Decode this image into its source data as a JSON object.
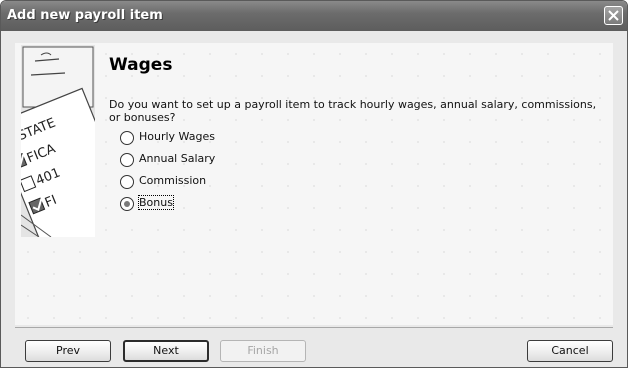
{
  "window": {
    "title": "Add new payroll item"
  },
  "icons": {
    "close": "close-icon",
    "illustration": "payroll-forms-illustration"
  },
  "illustration_text": [
    "STATE",
    "FICA",
    "401",
    "FI"
  ],
  "page": {
    "heading": "Wages",
    "question": "Do you want to set up a payroll item to track hourly wages, annual salary, commissions, or bonuses?"
  },
  "options": [
    {
      "label": "Hourly Wages",
      "checked": false
    },
    {
      "label": "Annual Salary",
      "checked": false
    },
    {
      "label": "Commission",
      "checked": false
    },
    {
      "label": "Bonus",
      "checked": true
    }
  ],
  "buttons": {
    "prev": "Prev",
    "next": "Next",
    "finish": "Finish",
    "cancel": "Cancel"
  }
}
